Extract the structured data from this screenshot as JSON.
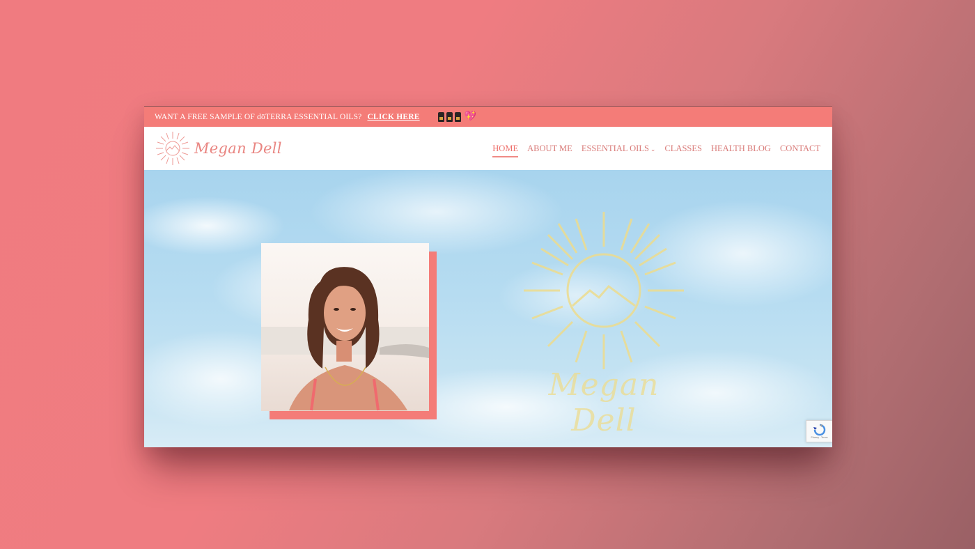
{
  "announcement": {
    "message": "WANT A FREE SAMPLE OF dōTERRA ESSENTIAL OILS?",
    "cta_label": "CLICK HERE",
    "heart": "💖"
  },
  "brand": {
    "name": "Megan Dell",
    "color": "#e98581"
  },
  "nav": {
    "items": [
      {
        "label": "HOME",
        "active": true
      },
      {
        "label": "ABOUT ME"
      },
      {
        "label": "ESSENTIAL OILS",
        "has_dropdown": true
      },
      {
        "label": "CLASSES"
      },
      {
        "label": "HEALTH BLOG"
      },
      {
        "label": "CONTACT"
      }
    ],
    "dropdown_icon": "⌄"
  },
  "hero": {
    "logo_text": "Megan Dell",
    "logo_color": "#eddc8e",
    "accent_color": "#f47c78"
  },
  "recaptcha": {
    "text": "Privacy - Terms"
  }
}
